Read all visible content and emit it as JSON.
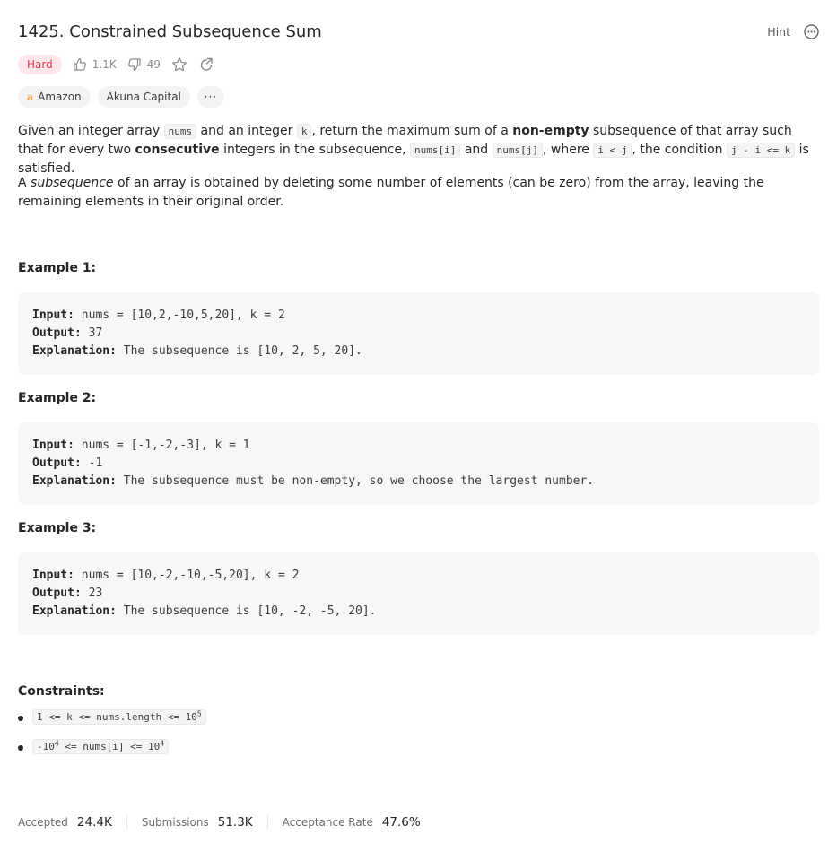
{
  "problem": {
    "title": "1425. Constrained Subsequence Sum",
    "hint_label": "Hint",
    "difficulty": "Hard",
    "likes": "1.1K",
    "dislikes": "49"
  },
  "tags": [
    {
      "label": "Amazon",
      "icon": "amazon-logo"
    },
    {
      "label": "Akuna Capital"
    },
    {
      "label": "···"
    }
  ],
  "description": {
    "p1": {
      "t1": "Given an integer array ",
      "c1": "nums",
      "t2": " and an integer ",
      "c2": "k",
      "t3": ", return the maximum sum of a ",
      "b1": "non-empty",
      "t4": " subsequence of that array such that for every two ",
      "b2": "consecutive",
      "t5": " integers in the subsequence, ",
      "c3": "nums[i]",
      "t6": " and ",
      "c4": "nums[j]",
      "t7": ", where ",
      "c5": "i < j",
      "t8": ", the condition ",
      "c6": "j - i <= k",
      "t9": " is satisfied."
    },
    "p2": {
      "t1": "A ",
      "i1": "subsequence",
      "t2": " of an array is obtained by deleting some number of elements (can be zero) from the array, leaving the remaining elements in their original order."
    }
  },
  "examples": [
    {
      "title": "Example 1:",
      "input_label": "Input:",
      "input": " nums = [10,2,-10,5,20], k = 2",
      "output_label": "Output:",
      "output": " 37",
      "explanation_label": "Explanation:",
      "explanation": " The subsequence is [10, 2, 5, 20]."
    },
    {
      "title": "Example 2:",
      "input_label": "Input:",
      "input": " nums = [-1,-2,-3], k = 1",
      "output_label": "Output:",
      "output": " -1",
      "explanation_label": "Explanation:",
      "explanation": " The subsequence must be non-empty, so we choose the largest number."
    },
    {
      "title": "Example 3:",
      "input_label": "Input:",
      "input": " nums = [10,-2,-10,-5,20], k = 2",
      "output_label": "Output:",
      "output": " 23",
      "explanation_label": "Explanation:",
      "explanation": " The subsequence is [10, -2, -5, 20]."
    }
  ],
  "constraints": {
    "title": "Constraints:",
    "c1": {
      "base": "1 <= k <= nums.length <= 10",
      "sup": "5"
    },
    "c2": {
      "pre": "-10",
      "sup1": "4",
      "mid": " <= nums[i] <= 10",
      "sup2": "4"
    }
  },
  "stats": [
    {
      "label": "Accepted",
      "value": "24.4K"
    },
    {
      "label": "Submissions",
      "value": "51.3K"
    },
    {
      "label": "Acceptance Rate",
      "value": "47.6%"
    }
  ],
  "colors": {
    "difficulty_hard_bg": "#fde7ea",
    "difficulty_hard_text": "#e2384d",
    "code_block_bg": "#f7f7f8",
    "text": "#262626"
  }
}
